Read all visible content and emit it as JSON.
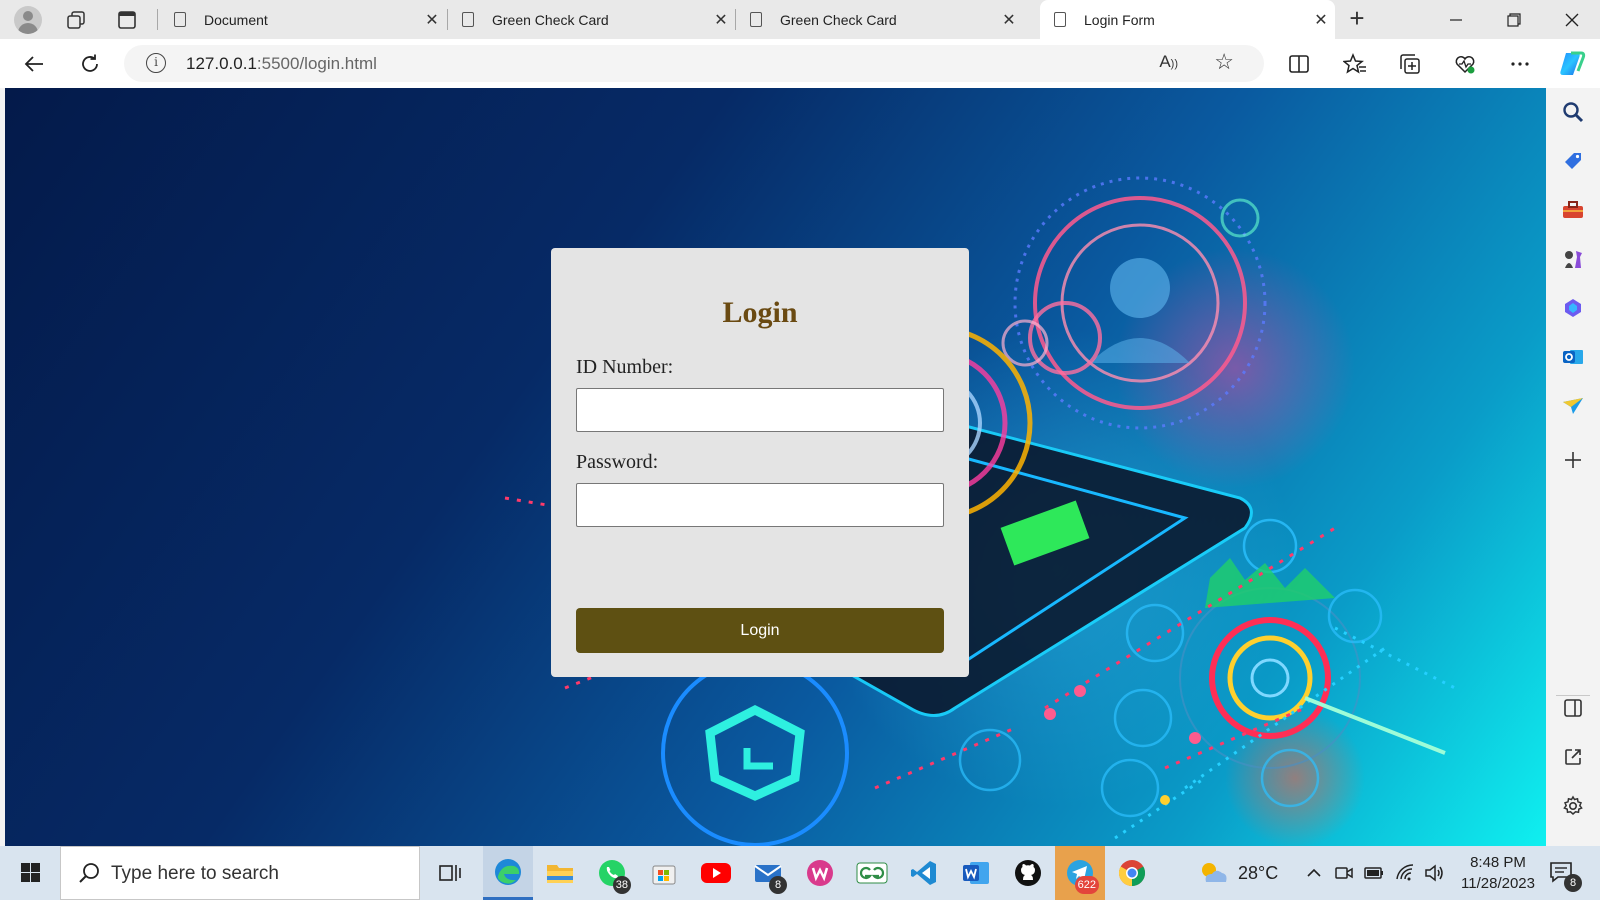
{
  "browser": {
    "tabs": [
      {
        "title": "Document",
        "active": false
      },
      {
        "title": "Green Check Card",
        "active": false
      },
      {
        "title": "Green Check Card",
        "active": false
      },
      {
        "title": "Login Form",
        "active": true
      }
    ],
    "new_tab_icon": "plus-icon",
    "window_controls": [
      "minimize-icon",
      "restore-icon",
      "close-icon"
    ],
    "address": {
      "host": "127.0.0.1",
      "rest": ":5500/login.html"
    }
  },
  "login": {
    "title": "Login",
    "id_label": "ID Number:",
    "id_value": "",
    "password_label": "Password:",
    "password_value": "",
    "submit_label": "Login"
  },
  "sidebar": {
    "items": [
      "search-icon",
      "shopping-tag-icon",
      "toolbox-icon",
      "chess-icon",
      "copilot-icon",
      "outlook-icon",
      "send-icon",
      "add-icon",
      "split-panel-icon",
      "external-link-icon",
      "settings-icon"
    ]
  },
  "taskbar": {
    "search_placeholder": "Type here to search",
    "badges": {
      "whatsapp": "38",
      "mail": "8",
      "telegram": "622",
      "notifications": "8"
    },
    "weather": "28°C",
    "time": "8:48 PM",
    "date": "11/28/2023"
  },
  "colors": {
    "accent": "#5e5012",
    "title": "#6a4a12",
    "card": "#e4e4e4"
  }
}
